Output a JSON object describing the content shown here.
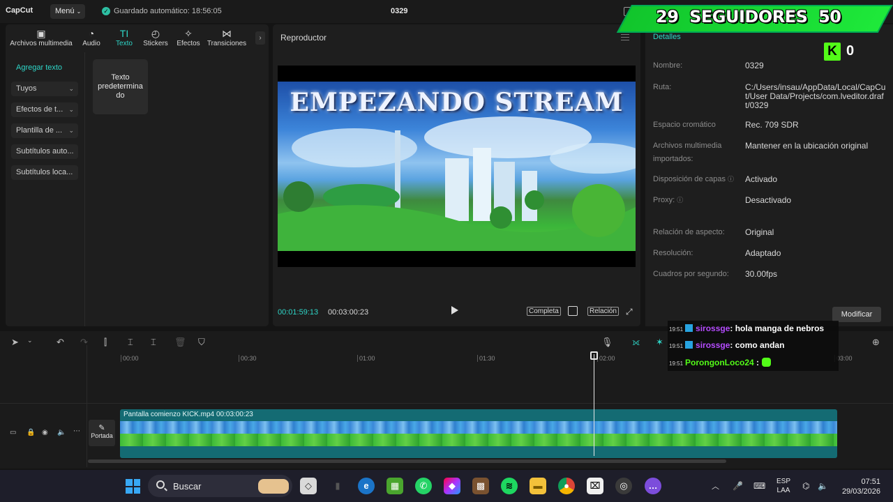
{
  "titlebar": {
    "logo": "CapCut",
    "menu_label": "Menú",
    "autosave": "Guardado automático: 18:56:05",
    "project_name": "0329"
  },
  "overlay": {
    "followers_text": "29  SEGUIDORES  50",
    "kick_label": "K",
    "kick_count": "0"
  },
  "left_panel": {
    "tabs": [
      {
        "label": "Archivos multimedia",
        "icon": "media-icon"
      },
      {
        "label": "Audio",
        "icon": "audio-icon"
      },
      {
        "label": "Texto",
        "icon": "text-icon"
      },
      {
        "label": "Stickers",
        "icon": "stickers-icon"
      },
      {
        "label": "Efectos",
        "icon": "effects-icon"
      },
      {
        "label": "Transiciones",
        "icon": "transitions-icon"
      }
    ],
    "side_items": [
      {
        "label": "Agregar texto"
      },
      {
        "label": "Tuyos"
      },
      {
        "label": "Efectos de t..."
      },
      {
        "label": "Plantilla de ..."
      },
      {
        "label": "Subtítulos auto..."
      },
      {
        "label": "Subtítulos loca..."
      }
    ],
    "card_label": "Texto predetermina do"
  },
  "player": {
    "title": "Reproductor",
    "video_title": "EMPEZANDO STREAM",
    "time_current": "00:01:59:13",
    "time_total": "00:03:00:23",
    "full_label": "Completa",
    "ratio_label": "Relación"
  },
  "details": {
    "title": "Detalles",
    "rows": [
      {
        "label": "Nombre:",
        "value": "0329"
      },
      {
        "label": "Ruta:",
        "value": "C:/Users/insau/AppData/Local/CapCut/User Data/Projects/com.lveditor.draft/0329"
      },
      {
        "label": "Espacio cromático",
        "value": "Rec. 709 SDR"
      },
      {
        "label": "Archivos multimedia importados:",
        "value": "Mantener en la ubicación original"
      },
      {
        "label": "Disposición de capas",
        "value": "Activado"
      },
      {
        "label": "Proxy:",
        "value": "Desactivado"
      },
      {
        "label": "Relación de aspecto:",
        "value": "Original"
      },
      {
        "label": "Resolución:",
        "value": "Adaptado"
      },
      {
        "label": "Cuadros por segundo:",
        "value": "30.00fps"
      }
    ],
    "modify_label": "Modificar"
  },
  "timeline": {
    "ticks": [
      "00:00",
      "00:30",
      "01:00",
      "01:30",
      "02:00",
      "03:00"
    ],
    "cover_label": "Portada",
    "clip_name": "Pantalla comienzo KICK.mp4",
    "clip_duration": "00:03:00:23"
  },
  "chat": {
    "messages": [
      {
        "time": "19:51",
        "user": "sirossge",
        "text": ": hola manga de nebros"
      },
      {
        "time": "19:51",
        "user": "sirossge",
        "text": ": como andan"
      },
      {
        "time": "19:51",
        "user": "PorongonLoco24",
        "text": " :"
      }
    ]
  },
  "taskbar": {
    "search_label": "Buscar",
    "lang_top": "ESP",
    "lang_bottom": "LAA",
    "time": "07:51",
    "date": "29/03/2026"
  },
  "colors": {
    "accent": "#2ed6c8",
    "kick_green": "#53fc18",
    "panel": "#1e1e1e",
    "clip": "#146b73"
  }
}
